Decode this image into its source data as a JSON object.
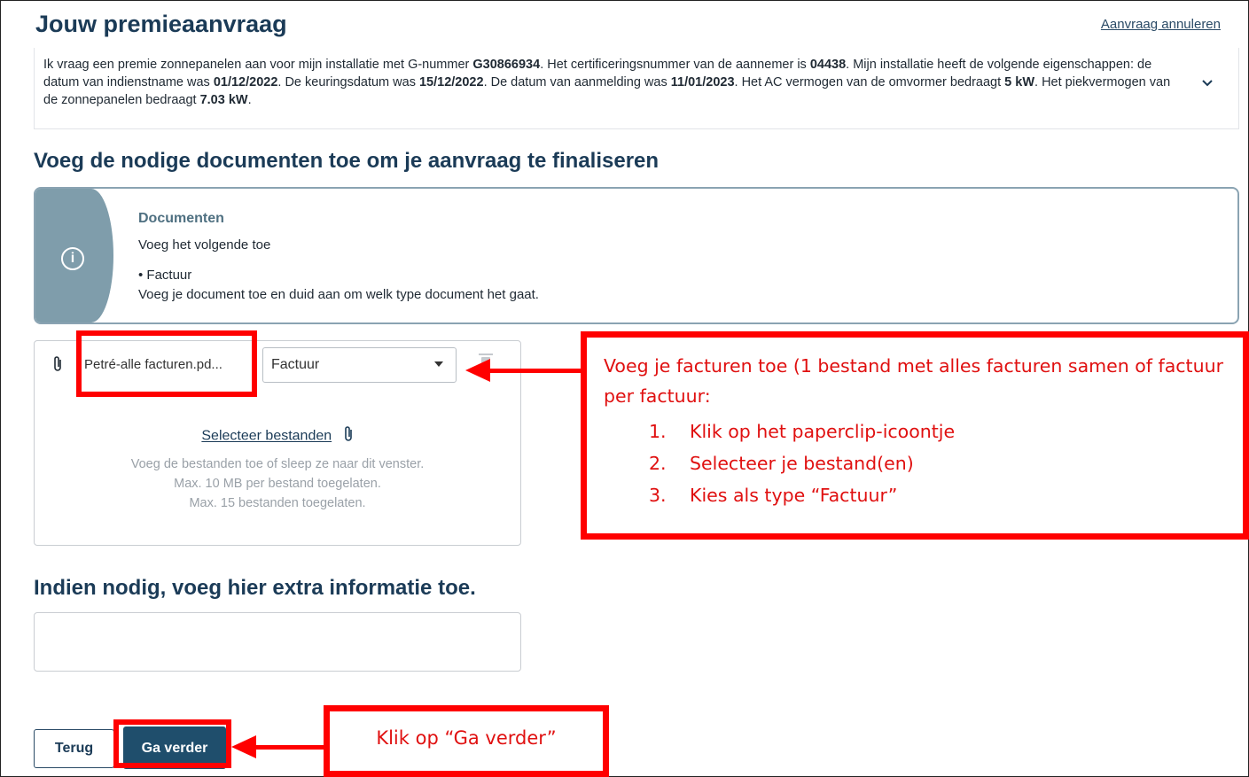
{
  "header": {
    "title": "Jouw premieaanvraag",
    "cancel_link": "Aanvraag annuleren"
  },
  "summary": {
    "p1": "Ik vraag een premie zonnepanelen aan voor mijn installatie met G-nummer ",
    "g_number": "G30866934",
    "p2": ". Het certificeringsnummer van de aannemer is ",
    "cert_number": "04438",
    "p3": ". Mijn installatie heeft de volgende eigenschappen: de datum van indienstname was ",
    "date_service": "01/12/2022",
    "p4": ". De keuringsdatum was ",
    "date_inspection": "15/12/2022",
    "p5": ". De datum van aanmelding was ",
    "date_registration": "11/01/2023",
    "p6": ". Het AC vermogen van de omvormer bedraagt ",
    "ac_power": "5 kW",
    "p7": ". Het piekvermogen van de zonnepanelen bedraagt ",
    "peak_power": "7.03 kW",
    "p8": "."
  },
  "documents_section": {
    "title": "Voeg de nodige documenten toe om je aanvraag te finaliseren",
    "info": {
      "title": "Documenten",
      "intro": "Voeg het volgende toe",
      "bullet": "• Factuur",
      "instruction": "Voeg je document toe en duid aan om welk type document het gaat."
    },
    "upload": {
      "file_name": "Petré-alle facturen.pd...",
      "doc_type": "Factuur",
      "select_files": "Selecteer bestanden",
      "hint1": "Voeg de bestanden toe of sleep ze naar dit venster.",
      "hint2": "Max. 10 MB per bestand toegelaten.",
      "hint3": "Max. 15 bestanden toegelaten."
    }
  },
  "extra_section": {
    "title": "Indien nodig, voeg hier extra informatie toe.",
    "value": ""
  },
  "buttons": {
    "back": "Terug",
    "next": "Ga verder"
  },
  "annotations": {
    "upload_callout": {
      "text": "Voeg je facturen toe (1 bestand met alles facturen samen of factuur per factuur:",
      "steps": [
        {
          "num": "1.",
          "text": "Klik op het paperclip-icoontje"
        },
        {
          "num": "2.",
          "text": "Selecteer je bestand(en)"
        },
        {
          "num": "3.",
          "text": "Kies als type “Factuur”"
        }
      ]
    },
    "next_callout": "Klik op “Ga verder”"
  },
  "colors": {
    "heading": "#1b3b57",
    "info_stripe": "#7f9dab",
    "primary_button": "#1f4e6c",
    "annotation_red": "#ff0000"
  },
  "icons": [
    "paperclip-icon",
    "info-icon",
    "chevron-down-icon",
    "trash-icon",
    "dropdown-arrow-icon"
  ]
}
